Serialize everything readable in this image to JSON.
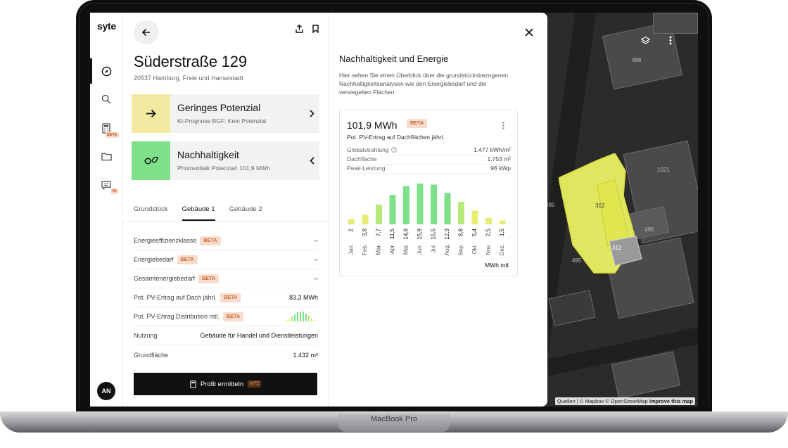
{
  "device": {
    "label": "MacBook Pro"
  },
  "rail": {
    "logo": "syte",
    "nav": [
      {
        "icon": "compass-icon",
        "badge": ""
      },
      {
        "icon": "search-icon",
        "badge": ""
      },
      {
        "icon": "calculator-icon",
        "badge": "BETA"
      },
      {
        "icon": "folder-icon",
        "badge": ""
      },
      {
        "icon": "chat-icon",
        "badge": "KI"
      }
    ],
    "avatar": "AN"
  },
  "panel": {
    "address": "Süderstraße 129",
    "address_sub": "20537 Hamburg, Freie und Hansestadt",
    "cards": [
      {
        "title": "Geringes Potenzial",
        "subtitle": "KI-Prognose  BGF: Kein Potenzial",
        "color": "#f2eaa0"
      },
      {
        "title": "Nachhaltigkeit",
        "subtitle": "Photovoltaik Potenzial: 101,9 MWh",
        "color": "#7fe08a"
      }
    ],
    "tabs": [
      "Grundstück",
      "Gebäude 1",
      "Gebäude 2"
    ],
    "active_tab": "Gebäude 1",
    "rows": [
      {
        "label": "Energieeffizienzklasse",
        "beta": "BETA",
        "value": "–"
      },
      {
        "label": "Energiebedarf",
        "beta": "BETA",
        "value": "–"
      },
      {
        "label": "Gesamtenergiebedarf",
        "beta": "BETA",
        "value": "–"
      },
      {
        "label": "Pot. PV-Ertrag auf Dach jährl.",
        "beta": "BETA",
        "value": "83,3 MWh"
      },
      {
        "label": "Pot. PV-Ertrag Distribution mtl.",
        "beta": "BETA",
        "value": ""
      },
      {
        "label": "Nutzung",
        "beta": "",
        "value": "Gebäude für Handel und Dienstleistungen"
      },
      {
        "label": "Grundfläche",
        "beta": "",
        "value": "1.432 m²"
      }
    ],
    "cta": {
      "label": "Profit ermitteln",
      "badge": "VITZ"
    }
  },
  "detail": {
    "title": "Nachhaltigkeit und Energie",
    "description": "Hier sehen Sie einen Überblick über die grundstücksbezogenen Nachhaltigkeitsanalysen wie den Energiebedarf und die versiegelten Flächen.",
    "card": {
      "value": "101,9 MWh",
      "beta": "BETA",
      "subtitle": "Pot. PV-Ertrag auf Dachflächen jährl.",
      "stats": [
        {
          "label": "Globalstrahlung",
          "value": "1.477 kWh/m²"
        },
        {
          "label": "Dachfläche",
          "value": "1.753 m²"
        },
        {
          "label": "Peak-Leistung",
          "value": "96 kWp"
        }
      ]
    }
  },
  "chart_data": {
    "type": "bar",
    "categories": [
      "Jan.",
      "Feb.",
      "Mär.",
      "Apr.",
      "Mai.",
      "Jun.",
      "Jul.",
      "Aug.",
      "Sep.",
      "Okt.",
      "Nov.",
      "Dez."
    ],
    "values": [
      2,
      3.8,
      7.7,
      11.5,
      14.9,
      15.9,
      15.5,
      12.3,
      8.8,
      5.4,
      2.5,
      1.5
    ],
    "value_labels": [
      "2",
      "3,8",
      "7,7",
      "11,5",
      "14,9",
      "15,9",
      "15,5",
      "12,3",
      "8,8",
      "5,4",
      "2,5",
      "1,5"
    ],
    "unit_label": "MWh mtl.",
    "colors": {
      "high": "#7fe08a",
      "mid": "#b6ea7a",
      "low": "#e6ee72"
    }
  },
  "map": {
    "labels": [
      "486",
      "1021",
      "312",
      "312",
      "496",
      "495",
      "495"
    ],
    "attribution_prefix": "Quellen | © Mapbox © OpenStreetMap",
    "attribution_link": "Improve this map"
  }
}
